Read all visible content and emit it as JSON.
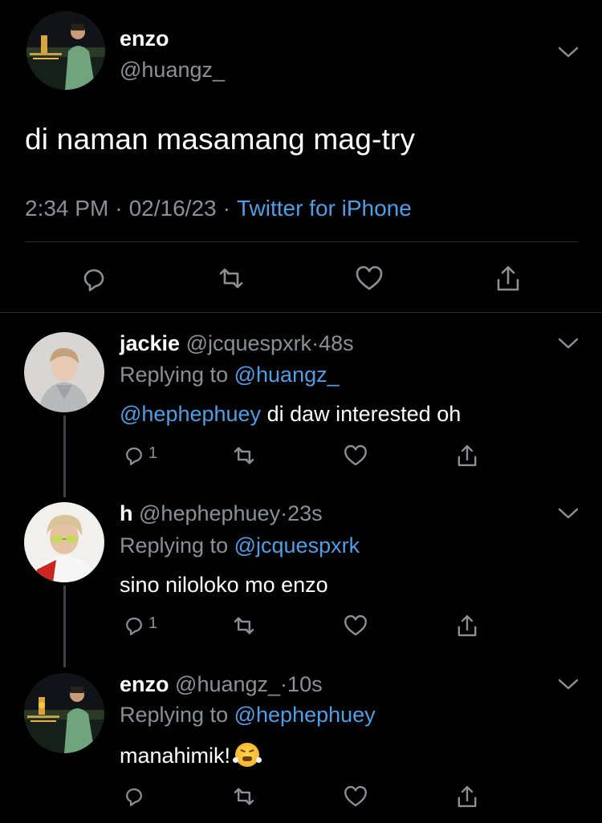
{
  "main_tweet": {
    "author": {
      "name": "enzo",
      "handle": "@huangz_",
      "avatar": "avatar-enzo"
    },
    "text": "di naman masamang mag-try",
    "time": "2:34 PM",
    "date": "02/16/23",
    "source": "Twitter for iPhone",
    "actions": [
      "reply-icon",
      "retweet-icon",
      "like-icon",
      "share-icon"
    ]
  },
  "replies": [
    {
      "name": "jackie",
      "handle": "@jcquespxrk",
      "time": "48s",
      "replying_prefix": "Replying to",
      "replying_to": "@huangz_",
      "mention": "@hephephuey",
      "text": "di daw interested oh",
      "reply_count": "1"
    },
    {
      "name": "h",
      "handle": "@hephephuey",
      "time": "23s",
      "replying_prefix": "Replying to",
      "replying_to": "@jcquespxrk",
      "text": "sino niloloko mo enzo",
      "reply_count": "1"
    },
    {
      "name": "enzo",
      "handle": "@huangz_",
      "time": "10s",
      "replying_prefix": "Replying to",
      "replying_to": "@hephephuey",
      "text": "manahimik!",
      "emoji": "face-with-steam-from-nose"
    }
  ],
  "separator": "·",
  "colors": {
    "background": "#000000",
    "text": "#ffffff",
    "secondary": "#8b9096",
    "link": "#4f9ee8",
    "divider": "#2a2d31"
  }
}
